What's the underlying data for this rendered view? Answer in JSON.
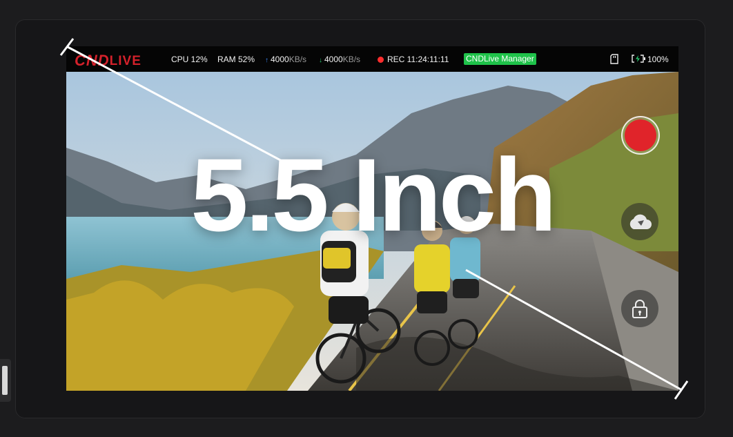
{
  "status_bar": {
    "logo_cnd": "CND",
    "logo_live": "LIVE",
    "cpu": "CPU 12%",
    "ram": "RAM 52%",
    "upload_value": "4000",
    "upload_unit": "KB/s",
    "download_value": "4000",
    "download_unit": "KB/s",
    "rec_time": "REC 11:24:11:11",
    "manager_button": "CNDLive Manager",
    "battery": "100%"
  },
  "overlay": {
    "headline": "5.5 Inch"
  },
  "icons": {
    "upload": "arrow-up-icon",
    "download": "arrow-down-icon",
    "rec": "rec-dot-icon",
    "sd": "sd-card-icon",
    "battery": "battery-charging-icon",
    "record": "record-icon",
    "cloud": "cloud-icon",
    "lock": "lock-icon"
  },
  "colors": {
    "logo_red": "#d4212b",
    "manager_green": "#1fc24a",
    "record_red": "#e0242a",
    "upload_blue": "#3b8cff",
    "download_green": "#28c76f"
  }
}
